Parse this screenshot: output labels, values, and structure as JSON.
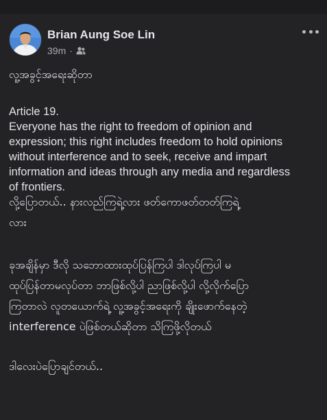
{
  "post": {
    "author": "Brian Aung Soe Lin",
    "time": "39m",
    "audience_icon": "friends-icon",
    "more_icon": "more-dots-icon",
    "lines": [
      "လူ့အခွင့်အရေးဆိုတာ",
      "Article 19.",
      "Everyone has the right to freedom of opinion and",
      "expression; this right includes freedom to hold opinions",
      "without interference and to seek, receive and impart",
      "information and ideas through any media and regardless",
      "of frontiers.",
      "လို့ပြောတယ်.. နားလည်ကြရဲ့လား ဖတ်ကောဖတ်တတ်ကြရဲ့",
      "လား",
      "ခုအချိန်မှာ ဒီလို သဘောထားထုပ်ပြန်ကြပါ ဒါလုပ်ကြပါ မ",
      "ထုပ်ပြန်တာမလုပ်တာ ဘာဖြစ်လို့ပါ ညာဖြစ်လို့ပါ လို့လိုက်ပြော",
      "ကြတာလဲ လူတယောက်ရဲ့ လူ့အခွင့်အရေးကို ချိုးဖောက်နေတဲ့",
      "interference ပဲဖြစ်တယ်ဆိုတာ သိကြဖို့လိုတယ်",
      "ဒါလေးပဲပြောချင်တယ်.."
    ]
  },
  "colors": {
    "background": "#000000",
    "card": "#232325",
    "text": "#e4e6eb",
    "secondary": "#a8abaf"
  }
}
